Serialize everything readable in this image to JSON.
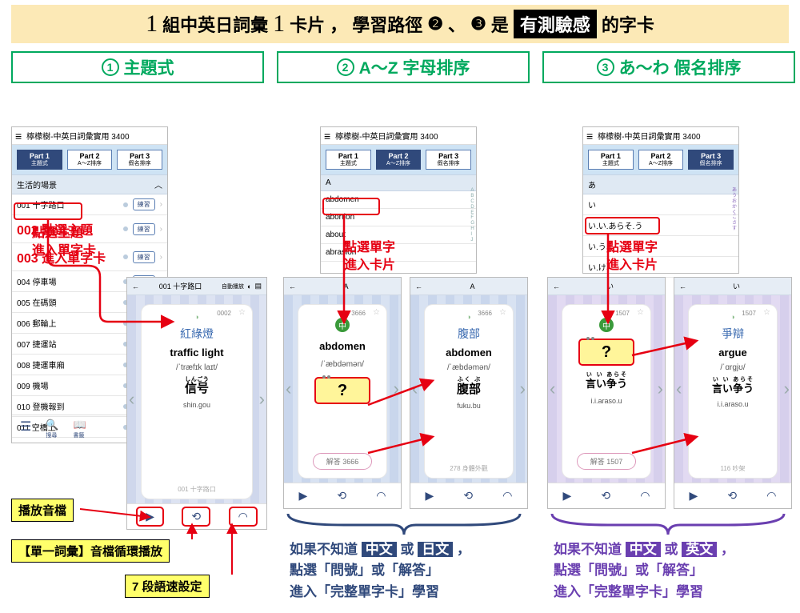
{
  "banner": {
    "a": "組中英日詞彙",
    "b": "卡片 ，",
    "c": "學習路徑",
    "d": "是",
    "e": "有測驗感",
    "f": "的字卡",
    "num2": "❷",
    "num3": "❸"
  },
  "heads": {
    "h1": "主題式",
    "h2": "A〜Z 字母排序",
    "h3": "あ〜わ 假名排序"
  },
  "app_title": "檸檬樹-中英日詞彙實用 3400",
  "parts": {
    "p1": "Part 1",
    "p2": "Part 2",
    "p3": "Part 3",
    "s1": "主題式",
    "s2": "A〜Z排序",
    "s3": "假名排序"
  },
  "l1": {
    "section": "生活的場景",
    "rows": [
      "001 十字路口",
      "002 點選主題",
      "003 進入單字卡",
      "004 停車場",
      "005 在碼頭",
      "006 郵輪上",
      "007 捷運站",
      "008 捷運車廂",
      "009 機場",
      "010 登機報到",
      "011 空橋上"
    ],
    "btn": "練習"
  },
  "l2": {
    "section": "A",
    "rows": [
      "abdomen",
      "abortion",
      "about",
      "abrasion"
    ]
  },
  "l3": {
    "section": "あ",
    "rows": [
      "い",
      "い.い.あらそ.う",
      "い.う",
      "い.け"
    ]
  },
  "card1": {
    "top": "001 十字路口",
    "num": "0002",
    "cn": "紅綠燈",
    "en": "traffic light",
    "ipa": "/ˈtræfɪk laɪt/",
    "jp": "信号",
    "jprt": "しんごう",
    "rom": "shin.gou",
    "foot": "001 十字路口"
  },
  "card2a": {
    "top": "A",
    "num": "3666",
    "en": "abdomen",
    "ipa": "/ˈæbdəmən/",
    "ans": "解答 3666"
  },
  "card2b": {
    "top": "A",
    "num": "3666",
    "cn": "腹部",
    "en": "abdomen",
    "ipa": "/ˈæbdəmən/",
    "jp": "腹部",
    "jprt": "ふく ぶ",
    "rom": "fuku.bu",
    "foot": "278 身體外觀"
  },
  "card3a": {
    "top": "い",
    "num": "1507",
    "jp": "言い争う",
    "jprt": "い い あらそ",
    "rom": "i.i.araso.u",
    "ans": "解答 1507"
  },
  "card3b": {
    "top": "い",
    "num": "1507",
    "cn": "爭辯",
    "en": "argue",
    "ipa": "/ˈɑrgjʊ/",
    "jp": "言い争う",
    "jprt": "い い あらそ",
    "rom": "i.i.araso.u",
    "foot": "116 吵架"
  },
  "anno": {
    "a1": "點選主題\n進入單字卡",
    "a2": "點選單字\n進入卡片",
    "a3": "點選單字\n進入卡片"
  },
  "yl": {
    "y1": "播放音檔",
    "y2": "【單一詞彙】音檔循環播放",
    "y3": "7 段語速設定"
  },
  "exp2": {
    "l1a": "如果不知道",
    "c1": "中文",
    "mid": "或",
    "c2": "日文",
    "tail": "，",
    "l2": "點選「問號」或「解答」",
    "l3": "進入「完整單字卡」學習"
  },
  "exp3": {
    "l1a": "如果不知道",
    "c1": "中文",
    "mid": "或",
    "c2": "英文",
    "tail": "，",
    "l2": "點選「問號」或「解答」",
    "l3": "進入「完整單字卡」學習"
  }
}
